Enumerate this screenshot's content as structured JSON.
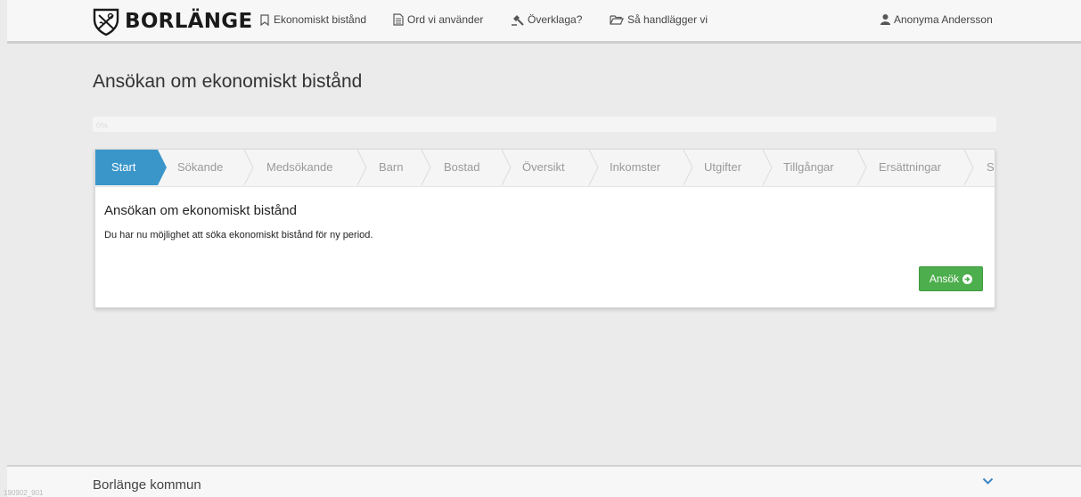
{
  "header": {
    "brand": "BORLÄNGE",
    "nav": [
      {
        "label": "Ekonomiskt bistånd",
        "icon": "bookmark-icon"
      },
      {
        "label": "Ord vi använder",
        "icon": "document-icon"
      },
      {
        "label": "Överklaga?",
        "icon": "gavel-icon"
      },
      {
        "label": "Så handlägger vi",
        "icon": "folder-open-icon"
      }
    ],
    "user": {
      "label": "Anonyma Andersson",
      "icon": "user-icon"
    }
  },
  "page": {
    "title": "Ansökan om ekonomiskt bistånd",
    "progress_label": "0%",
    "progress_value": 0
  },
  "wizard": {
    "steps": [
      "Start",
      "Sökande",
      "Medsökande",
      "Barn",
      "Bostad",
      "Översikt",
      "Inkomster",
      "Utgifter",
      "Tillgångar",
      "Ersättningar",
      "S"
    ],
    "active_step": "Start"
  },
  "content": {
    "title": "Ansökan om ekonomiskt bistånd",
    "text": "Du har nu möjlighet att söka ekonomiskt bistånd för ny period.",
    "apply_label": "Ansök"
  },
  "footer": {
    "title": "Borlänge kommun",
    "version": "190902_901"
  },
  "colors": {
    "active_step": "#3a96c9",
    "apply_button": "#4cae4c",
    "background": "#ebebeb"
  }
}
